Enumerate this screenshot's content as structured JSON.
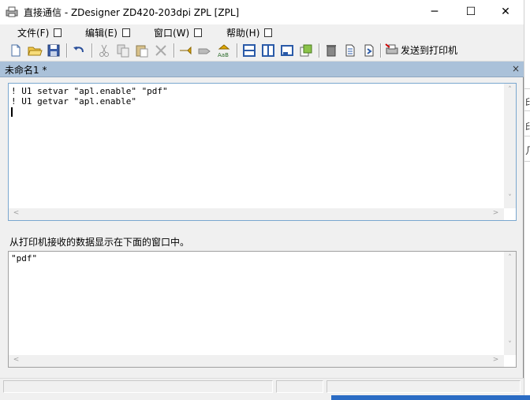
{
  "window": {
    "title": "直接通信 - ZDesigner ZD420-203dpi ZPL [ZPL]"
  },
  "title_buttons": {
    "minimize": "─",
    "maximize": "☐",
    "close": "✕"
  },
  "menu": {
    "items": [
      {
        "label": "文件(F)"
      },
      {
        "label": "编辑(E)"
      },
      {
        "label": "窗口(W)"
      },
      {
        "label": "帮助(H)"
      }
    ]
  },
  "toolbar": {
    "icons": [
      "new-document-icon",
      "open-folder-icon",
      "save-icon",
      "undo-icon",
      "cut-icon",
      "copy-icon",
      "paste-icon",
      "delete-icon",
      "send-back-icon",
      "send-forward-icon",
      "abc-font-icon",
      "horizontal-split-icon",
      "vertical-split-icon",
      "window-icon",
      "tile-icon",
      "clear-icon",
      "page-icon",
      "page-arrow-icon",
      "printer-send-icon"
    ],
    "send_label": "发送到打印机"
  },
  "document": {
    "title": "未命名1 *",
    "close": "×",
    "command_lines": [
      "! U1 setvar \"apl.enable\" \"pdf\"",
      "! U1 getvar \"apl.enable\""
    ]
  },
  "received": {
    "label": "从打印机接收的数据显示在下面的窗口中。",
    "lines": [
      "\"pdf\""
    ]
  },
  "scroll_arrows": {
    "up": "˄",
    "down": "˅",
    "left": "<",
    "right": ">"
  },
  "background_app": {
    "glyphs": [
      "印",
      "印",
      "几"
    ]
  },
  "colors": {
    "caption_bar": "#aac1d9",
    "accent_blue": "#2b6cc4",
    "editor_border": "#7aa7cf"
  }
}
